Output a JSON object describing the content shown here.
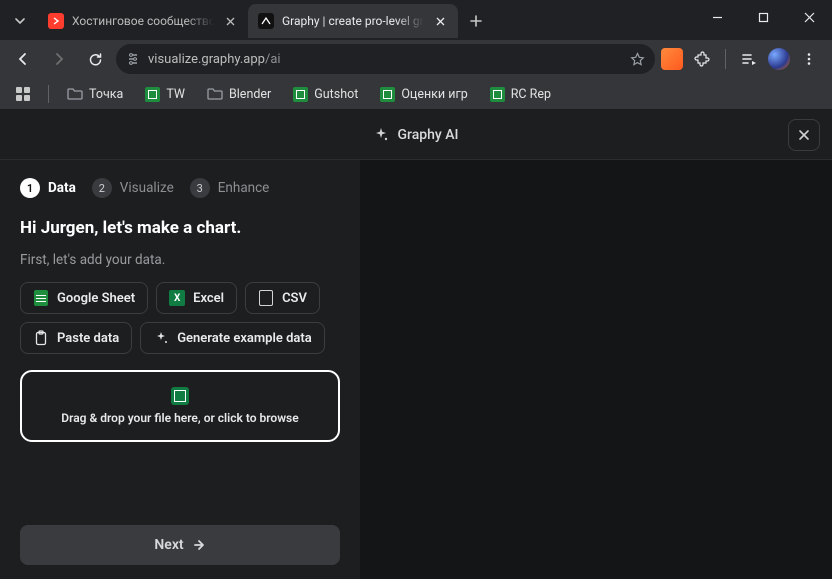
{
  "browser": {
    "tabs": [
      {
        "title": "Хостинговое сообщество «Tin",
        "favicon_bg": "#ff3d2e",
        "active": false
      },
      {
        "title": "Graphy | create pro-level graph",
        "favicon_bg": "#111111",
        "active": true
      }
    ],
    "url_host": "visualize.graphy.app",
    "url_path": "/ai"
  },
  "bookmarks": [
    {
      "type": "folder",
      "label": "Точка"
    },
    {
      "type": "sheet",
      "label": "TW"
    },
    {
      "type": "folder",
      "label": "Blender"
    },
    {
      "type": "sheet",
      "label": "Gutshot"
    },
    {
      "type": "sheet",
      "label": "Оценки игр"
    },
    {
      "type": "sheet",
      "label": "RC Rep"
    }
  ],
  "app": {
    "brand": "Graphy AI",
    "steps": [
      {
        "num": "1",
        "label": "Data",
        "active": true
      },
      {
        "num": "2",
        "label": "Visualize",
        "active": false
      },
      {
        "num": "3",
        "label": "Enhance",
        "active": false
      }
    ],
    "greeting": "Hi Jurgen, let's make a chart.",
    "subtext": "First, let's add your data.",
    "sources": {
      "google_sheet": "Google Sheet",
      "excel": "Excel",
      "csv": "CSV",
      "paste": "Paste data",
      "generate": "Generate example data"
    },
    "dropzone": "Drag & drop your file here, or click to browse",
    "next": "Next"
  }
}
